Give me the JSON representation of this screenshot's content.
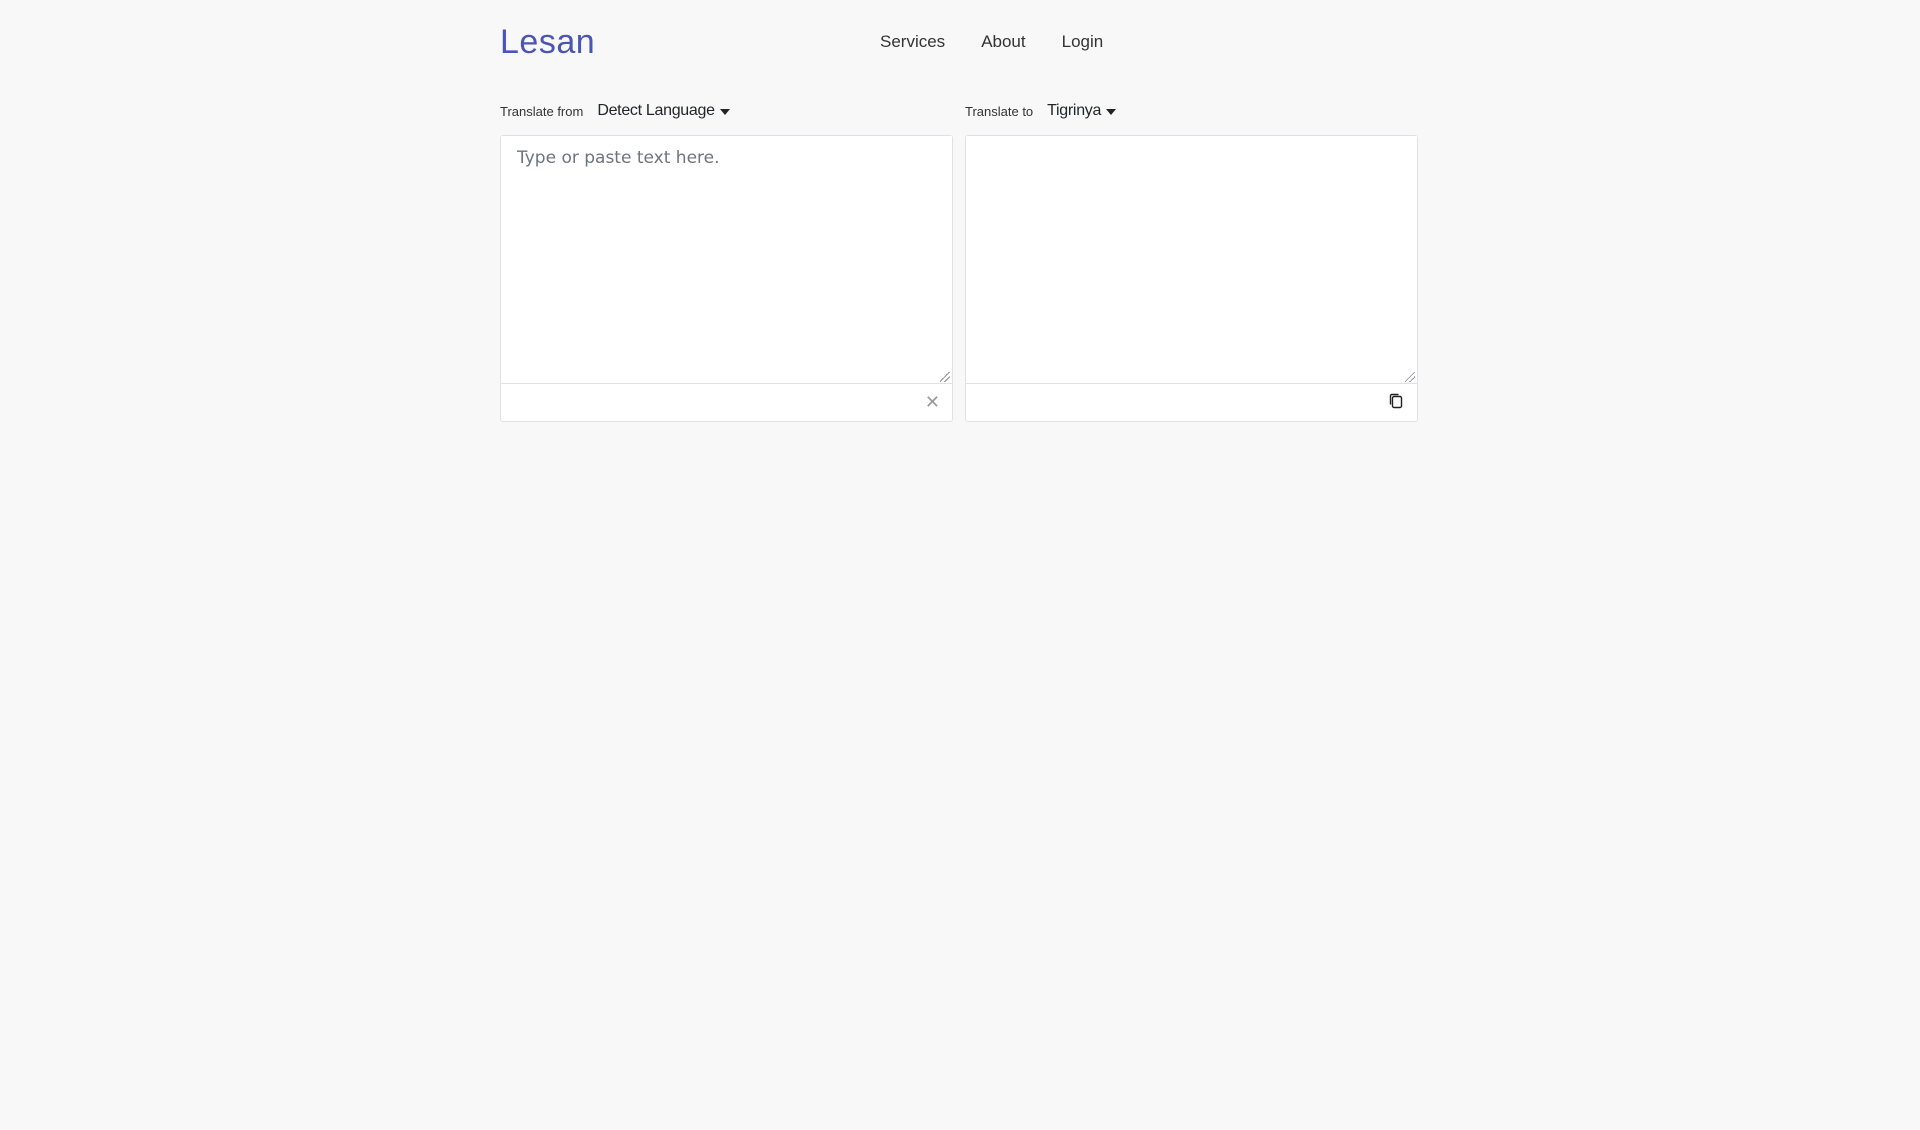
{
  "header": {
    "brand": "Lesan",
    "nav": [
      {
        "label": "Services"
      },
      {
        "label": "About"
      },
      {
        "label": "Login"
      }
    ]
  },
  "source": {
    "label": "Translate from",
    "language": "Detect Language",
    "placeholder": "Type or paste text here.",
    "value": ""
  },
  "target": {
    "label": "Translate to",
    "language": "Tigrinya",
    "value": ""
  },
  "colors": {
    "brand": "#4a55b4",
    "background": "#f8f8f8"
  },
  "icons": {
    "clear": "close-icon",
    "copy": "copy-icon"
  }
}
